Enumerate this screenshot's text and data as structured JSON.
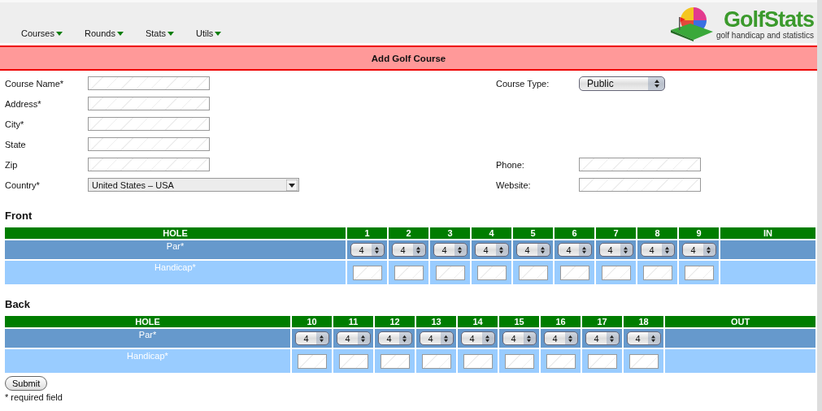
{
  "menu": [
    {
      "label": "Courses"
    },
    {
      "label": "Rounds"
    },
    {
      "label": "Stats"
    },
    {
      "label": "Utils"
    }
  ],
  "logo": {
    "name": "GolfStats",
    "tagline": "golf handicap and statistics"
  },
  "title": "Add Golf Course",
  "form_rows": [
    {
      "left": {
        "label": "Course Name*",
        "kind": "text"
      },
      "right": {
        "label": "Course Type:",
        "kind": "stepper",
        "value": "Public"
      }
    },
    {
      "left": {
        "label": "Address*",
        "kind": "text"
      }
    },
    {
      "left": {
        "label": "City*",
        "kind": "text"
      }
    },
    {
      "left": {
        "label": "State",
        "kind": "text"
      }
    },
    {
      "left": {
        "label": "Zip",
        "kind": "text"
      },
      "right": {
        "label": "Phone:",
        "kind": "text"
      }
    },
    {
      "left": {
        "label": "Country*",
        "kind": "dropdown",
        "value": "United States – USA"
      },
      "right": {
        "label": "Website:",
        "kind": "text"
      }
    }
  ],
  "sections": [
    {
      "heading": "Front",
      "hole_label": "HOLE",
      "par_label": "Par*",
      "handicap_label": "Handicap*",
      "total_label": "IN",
      "holes": [
        {
          "number": "1",
          "par": "4"
        },
        {
          "number": "2",
          "par": "4"
        },
        {
          "number": "3",
          "par": "4"
        },
        {
          "number": "4",
          "par": "4"
        },
        {
          "number": "5",
          "par": "4"
        },
        {
          "number": "6",
          "par": "4"
        },
        {
          "number": "7",
          "par": "4"
        },
        {
          "number": "8",
          "par": "4"
        },
        {
          "number": "9",
          "par": "4"
        }
      ]
    },
    {
      "heading": "Back",
      "hole_label": "HOLE",
      "par_label": "Par*",
      "handicap_label": "Handicap*",
      "total_label": "OUT",
      "holes": [
        {
          "number": "10",
          "par": "4"
        },
        {
          "number": "11",
          "par": "4"
        },
        {
          "number": "12",
          "par": "4"
        },
        {
          "number": "13",
          "par": "4"
        },
        {
          "number": "14",
          "par": "4"
        },
        {
          "number": "15",
          "par": "4"
        },
        {
          "number": "16",
          "par": "4"
        },
        {
          "number": "17",
          "par": "4"
        },
        {
          "number": "18",
          "par": "4"
        }
      ]
    }
  ],
  "submit": "Submit",
  "note": "* required field"
}
